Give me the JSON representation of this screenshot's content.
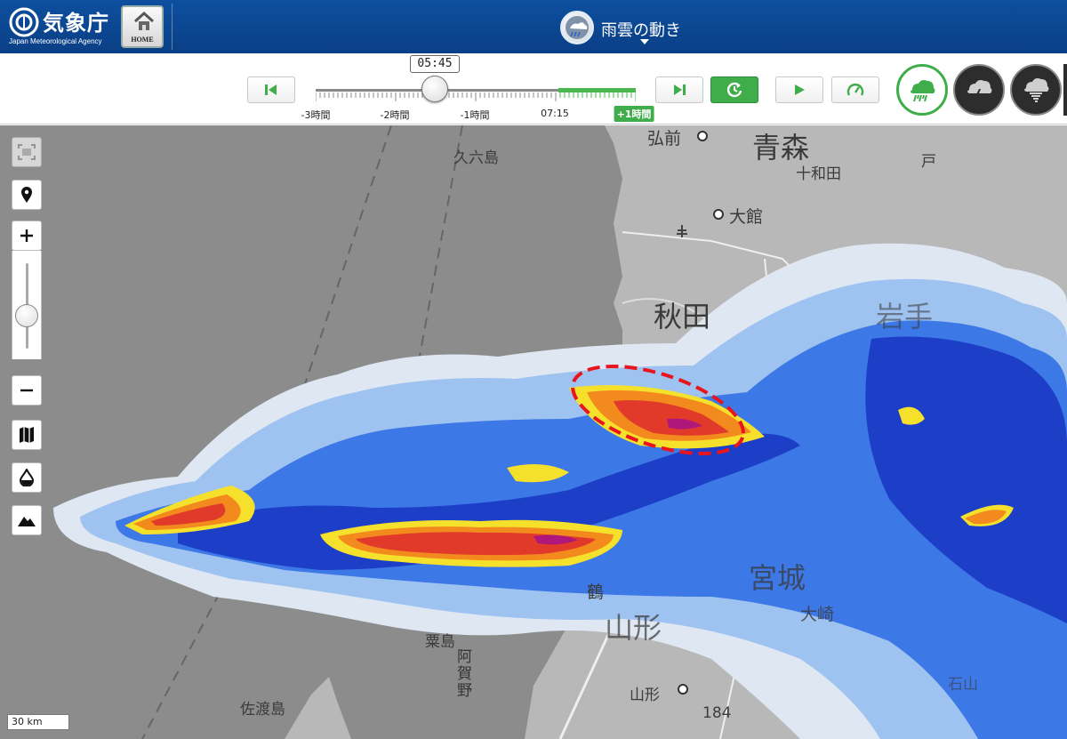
{
  "header": {
    "logo_text": "気象庁",
    "logo_sub": "Japan Meteorological Agency",
    "home_label": "HOME",
    "title": "雨雲の動き"
  },
  "timeline": {
    "current_time": "05:45",
    "ticks": [
      "-3時間",
      "-2時間",
      "-1時間",
      "07:15",
      "+1時間"
    ]
  },
  "buttons": {
    "first_icon": "skip-to-start-icon",
    "last_icon": "skip-to-end-icon",
    "latest_icon": "refresh-latest-icon",
    "play_icon": "play-icon",
    "speed_icon": "speed-gauge-icon"
  },
  "modes": [
    {
      "name": "rain-cloud-icon",
      "active": true
    },
    {
      "name": "thunder-cloud-icon",
      "active": false
    },
    {
      "name": "tornado-cloud-icon",
      "active": false
    }
  ],
  "map": {
    "labels": {
      "aomori": "青森",
      "hirosaki": "弘前",
      "towada": "十和田",
      "ohe": "戸",
      "odate": "大館",
      "kyurokujima": "久六島",
      "akita": "秋田",
      "iwate": "岩手",
      "miyagi": "宮城",
      "osaki": "大崎",
      "yamagata_pref": "山形",
      "tsuru": "鶴",
      "yamagata_city": "山形",
      "awashima": "粟島",
      "sadogashima": "佐渡島",
      "agano": "阿賀野",
      "ishi": "石山",
      "route": "184"
    },
    "scale": "30 km",
    "colors": {
      "land": "#b8b8b8",
      "sea": "#8c8c8c",
      "rain_light": "#dfe7f2",
      "rain_blue": "#9fc3f0",
      "rain_mid": "#3c78e6",
      "rain_dark": "#1d3fc8",
      "rain_yellow": "#f5e12c",
      "rain_orange": "#f28a1e",
      "rain_red": "#e23a2a",
      "rain_purple": "#b0177a",
      "highlight": "#e8141e"
    }
  }
}
